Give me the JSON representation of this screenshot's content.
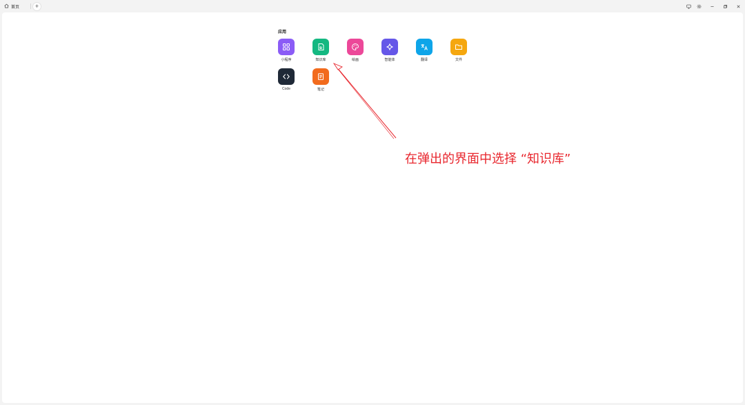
{
  "window": {
    "tab_label": "首页",
    "new_tab_symbol": "+"
  },
  "section": {
    "title": "应用"
  },
  "apps": [
    {
      "label": "小程序",
      "icon": "grid-icon",
      "color": "#8b5cf6"
    },
    {
      "label": "知识库",
      "icon": "book-icon",
      "color": "#14b881"
    },
    {
      "label": "绘画",
      "icon": "palette-icon",
      "color": "#ec4899"
    },
    {
      "label": "智能体",
      "icon": "sparkle-icon",
      "color": "#6557e8"
    },
    {
      "label": "翻译",
      "icon": "translate-icon",
      "color": "#0ea5e9"
    },
    {
      "label": "文件",
      "icon": "folder-icon",
      "color": "#f5a70f"
    },
    {
      "label": "Code",
      "icon": "code-icon",
      "color": "#1f2937"
    },
    {
      "label": "笔记",
      "icon": "note-icon",
      "color": "#f26b1d"
    }
  ],
  "annotation": {
    "text": "在弹出的界面中选择 “知识库”",
    "color": "#e8262d"
  }
}
